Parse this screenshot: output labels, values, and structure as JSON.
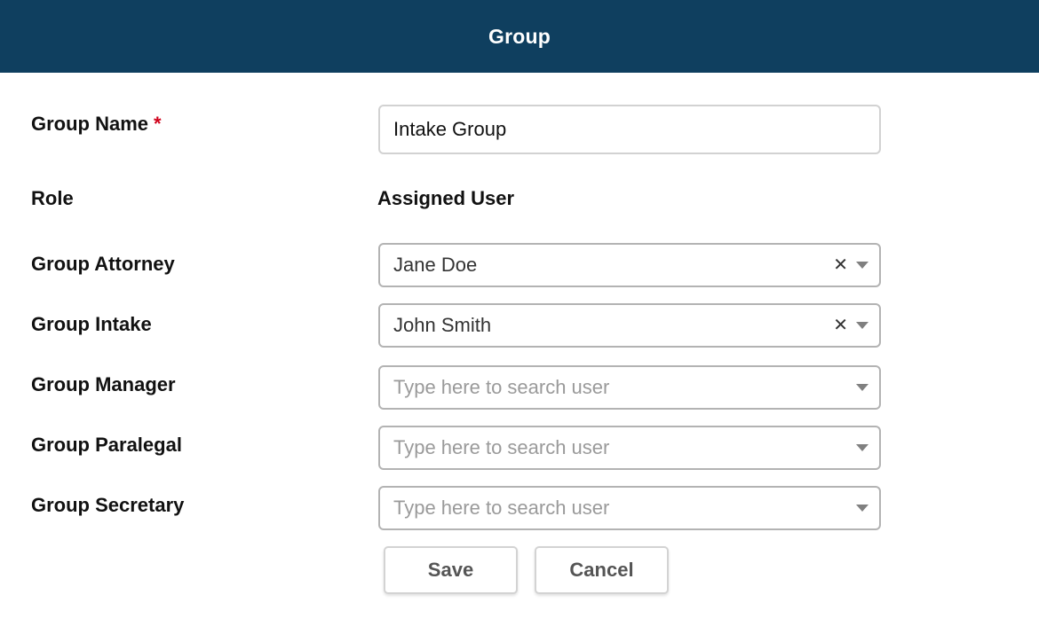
{
  "header": {
    "title": "Group"
  },
  "form": {
    "group_name": {
      "label": "Group Name",
      "required_mark": "*",
      "value": "Intake Group"
    },
    "columns": {
      "role": "Role",
      "assigned_user": "Assigned User"
    },
    "roles": [
      {
        "label": "Group Attorney",
        "value": "Jane Doe",
        "placeholder": "Type here to search user"
      },
      {
        "label": "Group Intake",
        "value": "John Smith",
        "placeholder": "Type here to search user"
      },
      {
        "label": "Group Manager",
        "value": "",
        "placeholder": "Type here to search user"
      },
      {
        "label": "Group Paralegal",
        "value": "",
        "placeholder": "Type here to search user"
      },
      {
        "label": "Group Secretary",
        "value": "",
        "placeholder": "Type here to search user"
      }
    ],
    "clear_icon": "close-icon",
    "dropdown_icon": "chevron-down-icon"
  },
  "buttons": {
    "save": "Save",
    "cancel": "Cancel"
  },
  "colors": {
    "header_bg": "#0f3f5f",
    "required": "#d0021b"
  }
}
